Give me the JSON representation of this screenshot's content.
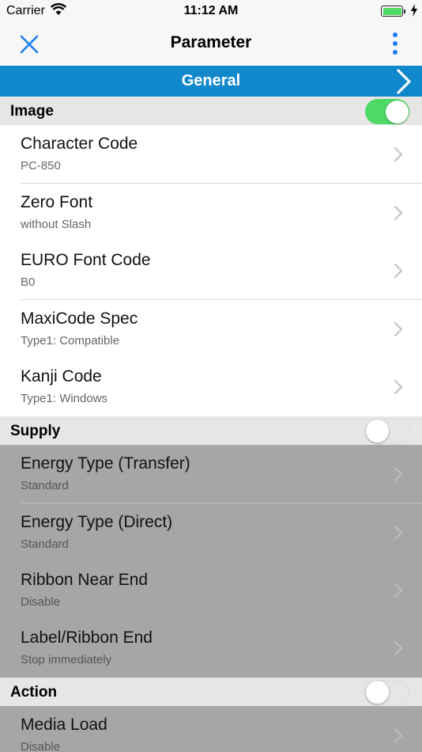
{
  "status_bar": {
    "carrier": "Carrier",
    "time": "11:12 AM"
  },
  "nav": {
    "title": "Parameter",
    "close_icon": "close-x-icon",
    "more_icon": "more-vertical-icon"
  },
  "banner": {
    "label": "General",
    "color": "#1188cc"
  },
  "groups": [
    {
      "label": "Image",
      "enabled": true,
      "rows": [
        {
          "title": "Character Code",
          "value": "PC-850"
        },
        {
          "title": "Zero Font",
          "value": "without Slash"
        },
        {
          "title": "EURO Font Code",
          "value": "B0"
        },
        {
          "title": "MaxiCode Spec",
          "value": "Type1: Compatible"
        },
        {
          "title": "Kanji Code",
          "value": "Type1: Windows"
        }
      ]
    },
    {
      "label": "Supply",
      "enabled": false,
      "rows": [
        {
          "title": "Energy Type (Transfer)",
          "value": "Standard"
        },
        {
          "title": "Energy Type (Direct)",
          "value": "Standard"
        },
        {
          "title": "Ribbon Near End",
          "value": "Disable"
        },
        {
          "title": "Label/Ribbon End",
          "value": "Stop immediately"
        }
      ]
    },
    {
      "label": "Action",
      "enabled": false,
      "rows": [
        {
          "title": "Media Load",
          "value": "Disable"
        }
      ]
    }
  ],
  "colors": {
    "accent": "#1188cc",
    "toggle_on": "#4cd964",
    "disabled_row": "#a6a6a6"
  }
}
